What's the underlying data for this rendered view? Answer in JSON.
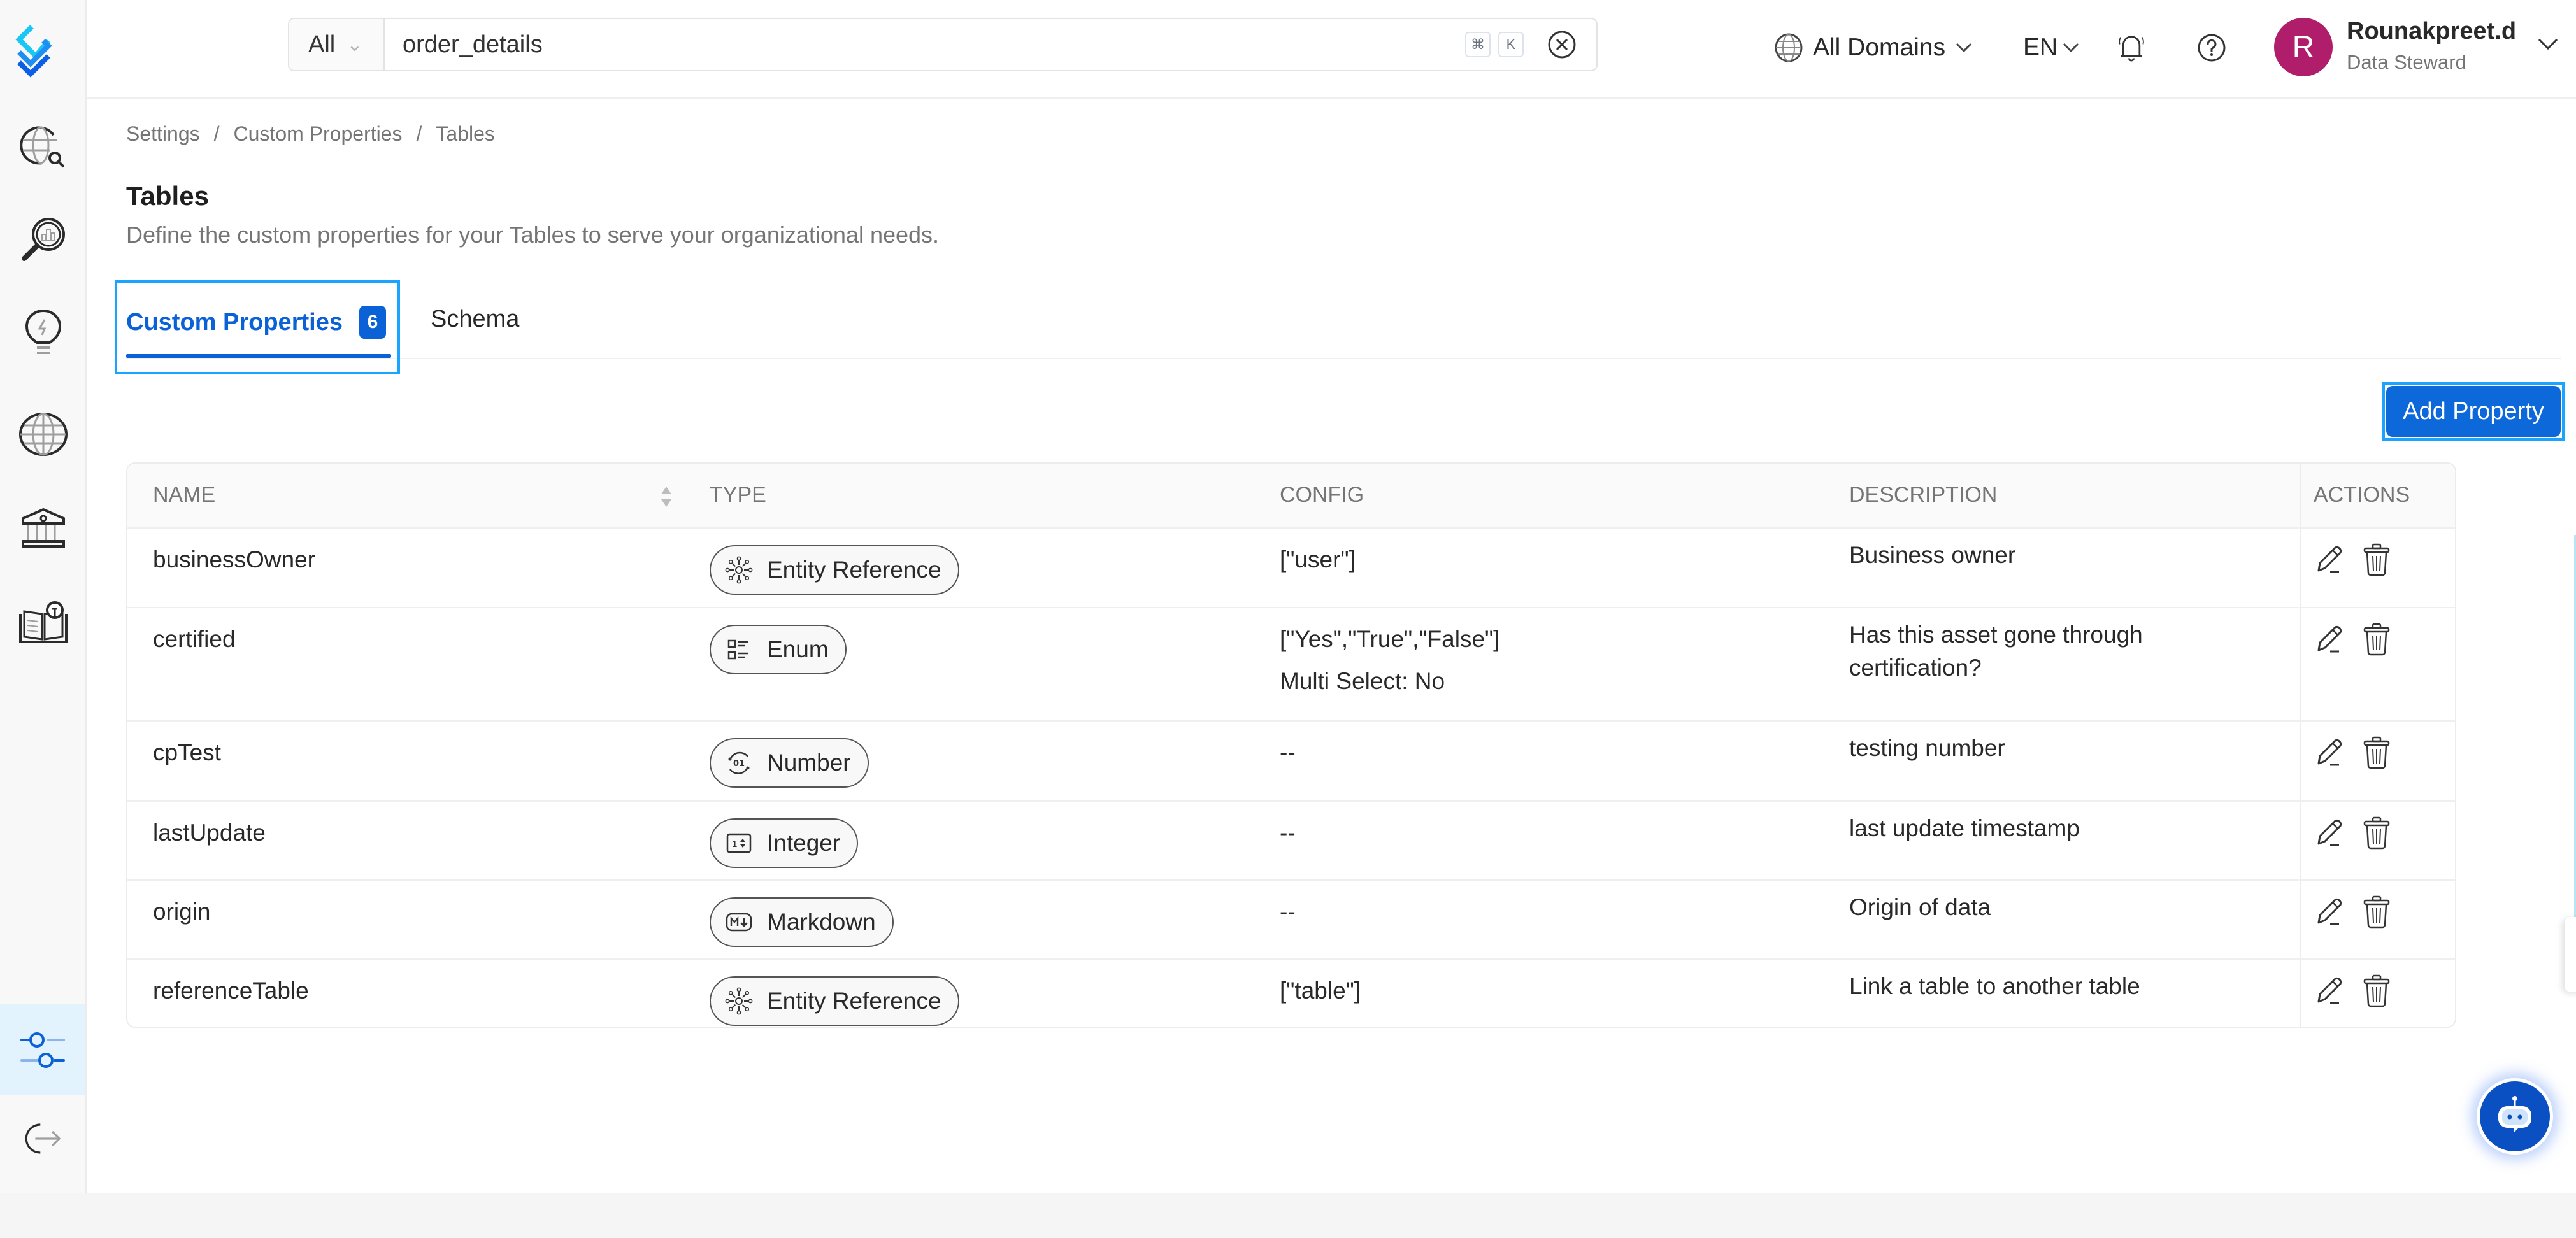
{
  "header": {
    "search": {
      "filter_label": "All",
      "value": "order_details",
      "placeholder": "",
      "shortcut_keys": [
        "⌘",
        "K"
      ]
    },
    "domain_selector": "All Domains",
    "language": "EN",
    "user": {
      "initial": "R",
      "name": "Rounakpreet.d",
      "role": "Data Steward",
      "avatar_color": "#b01d6a"
    }
  },
  "sidebar": {
    "items": [
      {
        "id": "explore",
        "icon": "globe-search-icon"
      },
      {
        "id": "observability",
        "icon": "magnifier-chart-icon"
      },
      {
        "id": "insights",
        "icon": "lightbulb-icon"
      },
      {
        "id": "domains",
        "icon": "globe-icon"
      },
      {
        "id": "governance",
        "icon": "bank-icon"
      },
      {
        "id": "knowledge",
        "icon": "book-idea-icon"
      },
      {
        "id": "settings",
        "icon": "sliders-icon",
        "active": true
      },
      {
        "id": "logout",
        "icon": "logout-icon"
      }
    ]
  },
  "breadcrumb": [
    {
      "label": "Settings"
    },
    {
      "label": "Custom Properties"
    },
    {
      "label": "Tables"
    }
  ],
  "breadcrumb_separator": "/",
  "page": {
    "title": "Tables",
    "description": "Define the custom properties for your Tables to serve your organizational needs."
  },
  "tabs": [
    {
      "label": "Custom Properties",
      "count": "6",
      "active": true
    },
    {
      "label": "Schema",
      "active": false
    }
  ],
  "add_property_label": "Add Property",
  "table": {
    "columns": [
      "NAME",
      "TYPE",
      "CONFIG",
      "DESCRIPTION",
      "ACTIONS"
    ],
    "rows": [
      {
        "name": "businessOwner",
        "type": "Entity Reference",
        "type_icon": "entity-reference-icon",
        "config": "[\"user\"]",
        "config2": "",
        "description": "Business owner"
      },
      {
        "name": "certified",
        "type": "Enum",
        "type_icon": "enum-icon",
        "config": "[\"Yes\",\"True\",\"False\"]",
        "config2": "Multi Select: No",
        "description": "Has this asset gone through certification?"
      },
      {
        "name": "cpTest",
        "type": "Number",
        "type_icon": "number-icon",
        "config": "--",
        "config2": "",
        "description": "testing number"
      },
      {
        "name": "lastUpdate",
        "type": "Integer",
        "type_icon": "integer-icon",
        "config": "--",
        "config2": "",
        "description": "last update timestamp"
      },
      {
        "name": "origin",
        "type": "Markdown",
        "type_icon": "markdown-icon",
        "config": "--",
        "config2": "",
        "description": "Origin of data"
      },
      {
        "name": "referenceTable",
        "type": "Entity Reference",
        "type_icon": "entity-reference-icon",
        "config": "[\"table\"]",
        "config2": "",
        "description": "Link a table to another table"
      }
    ]
  },
  "colors": {
    "accent": "#0b62d6",
    "button": "#0d68da",
    "focus_outline": "#1aa3ff",
    "sidebar_active_bg": "#e2f3fd",
    "chatbot": "#0b50c3"
  }
}
